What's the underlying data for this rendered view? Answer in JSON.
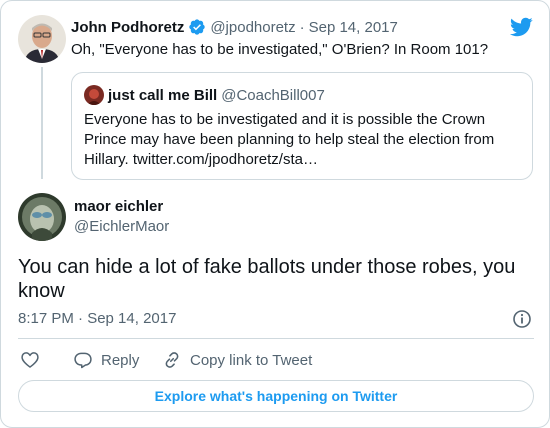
{
  "parent_tweet": {
    "author_name": "John Podhoretz",
    "handle": "@jpodhoretz",
    "separator": "·",
    "date": "Sep 14, 2017",
    "text": "Oh, \"Everyone has to be investigated,\" O'Brien? In Room 101?",
    "verified_icon": "verified-badge-icon"
  },
  "quoted_tweet": {
    "author_name": "just call me Bill",
    "handle": "@CoachBill007",
    "text": "Everyone has to be investigated and it is possible the Crown Prince may have been planning to help steal the election from Hillary. twitter.com/jpodhoretz/sta…"
  },
  "main_tweet": {
    "author_name": "maor eichler",
    "handle": "@EichlerMaor",
    "text": "You can hide a lot of fake ballots under those robes, you know",
    "timestamp": "8:17 PM · Sep 14, 2017"
  },
  "actions": {
    "like_icon": "heart-icon",
    "reply_label": "Reply",
    "copy_link_label": "Copy link to Tweet"
  },
  "explore_button_label": "Explore what's happening on Twitter",
  "colors": {
    "brand_blue": "#1d9bf0",
    "text_primary": "#0f1419",
    "text_secondary": "#536471",
    "border": "#cfd9de"
  }
}
